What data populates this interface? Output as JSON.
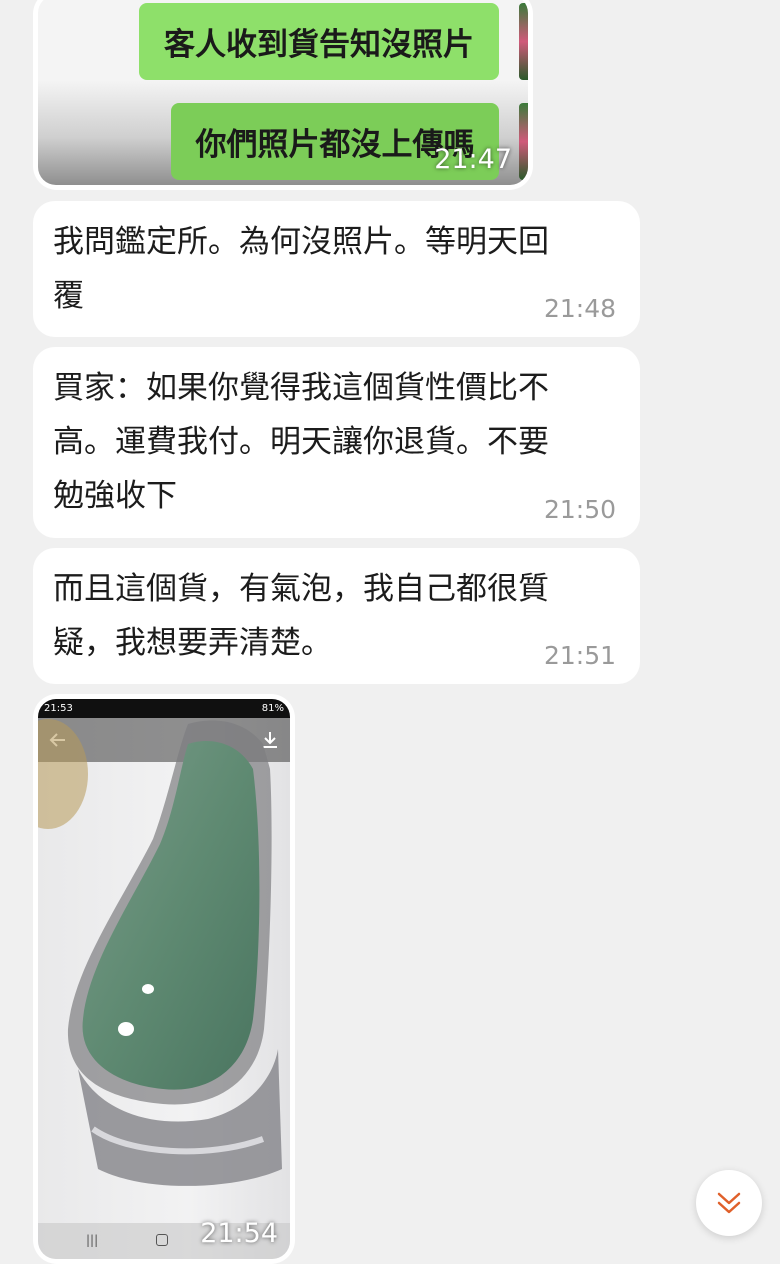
{
  "colors": {
    "background": "#f0f0f0",
    "bubble": "#ffffff",
    "green_bubble": "#8ee06a",
    "time_text": "#9a9a9a",
    "scroll_chevron": "#e0602a"
  },
  "screenshot_message": {
    "inner_lines": [
      "客人收到貨告知沒照片",
      "你們照片都沒上傳嗎"
    ],
    "time": "21:47"
  },
  "messages": [
    {
      "text": "我問鑑定所。為何沒照片。等明天回\n覆",
      "time": "21:48"
    },
    {
      "text": "買家：如果你覺得我這個貨性價比不\n高。運費我付。明天讓你退貨。不要\n勉強收下",
      "time": "21:50"
    },
    {
      "text": "而且這個貨，有氣泡，我自己都很質\n疑，我想要弄清楚。",
      "time": "21:51"
    }
  ],
  "photo_message": {
    "status_bar": {
      "time": "21:53",
      "battery": "81%"
    },
    "time": "21:54"
  },
  "scroll_button": {
    "icon": "double-chevron-down-icon"
  }
}
